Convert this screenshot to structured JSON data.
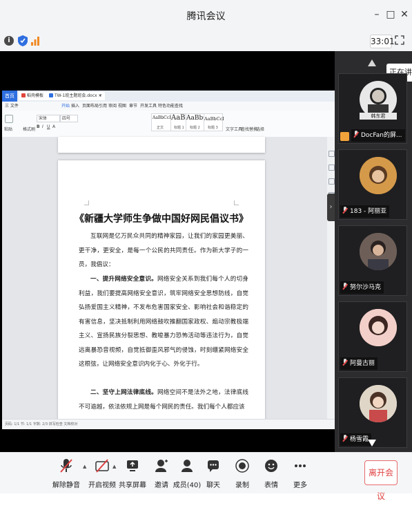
{
  "window": {
    "title": "腾讯会议"
  },
  "info_bar": {
    "timer": "33:01"
  },
  "shared_screen": {
    "wps": {
      "home_tab": "首页",
      "tabs": [
        "稻壳模板",
        "TW-1班主题班会.docx"
      ],
      "menus": [
        "三 文件",
        "开始",
        "插入",
        "页面布局",
        "引用",
        "审阅",
        "视图",
        "章节",
        "开发工具",
        "特色功能",
        "查找"
      ],
      "ribbon": {
        "paste": "粘贴",
        "format_brush": "格式刷",
        "font": "宋体",
        "font_size": "四号",
        "styles": [
          {
            "sample": "AaBbCcDd",
            "name": "正文"
          },
          {
            "sample": "AaBb",
            "name": "标题 1"
          },
          {
            "sample": "AaBbC",
            "name": "标题 2"
          },
          {
            "sample": "AaBbCcI",
            "name": "标题 3"
          }
        ],
        "text_tools": "文字工具",
        "find_replace": "查找替换",
        "select": "选择"
      },
      "document": {
        "title": "《新疆大学师生争做中国好网民倡议书》",
        "paragraphs": [
          {
            "lead": "",
            "text": "互联网是亿万民众共同的精神家园，让我们的家园更美丽、更干净，更安全，是每一个公民的共同责任。作为新大学子的一员，我倡议："
          },
          {
            "lead": "一、提升网络安全意识。",
            "text": "网络安全关系到我们每个人的切身利益，我们要提高网络安全意识，筑牢网络安全思想防线，自觉弘扬爱国主义精神，不发布危害国家安全、影响社会和谐稳定的有害信息，坚决抵制利用网络鼓吹推翻国家政权、煽动宗教极端主义、宣扬民族分裂思想、教唆暴力恐怖活动等违法行为，自觉远离暴恐音视频，自觉抵御歪风邪气的侵蚀，时刻绷紧网络安全这根弦，让网络安全意识内化于心、外化于行。"
          },
          {
            "lead": "二、坚守上网法律底线。",
            "text": "网络空间不是法外之地，法律底线不可逾越，依法依规上网是每个网民的责任。我们每个人都应该"
          }
        ]
      },
      "statusbar": "页码: 1/1  节: 1/1  字数: 2/3  拼写检查  文档校对"
    }
  },
  "side_panel": {
    "speaking_label": "正在讲话:",
    "participants": [
      {
        "name": "DocFan的屏...",
        "avatar_text": "韩东君",
        "sharing": true
      },
      {
        "name": "183 - 阿丽亚",
        "sharing": false
      },
      {
        "name": "努尔沙马克",
        "sharing": false
      },
      {
        "name": "阿曼古丽",
        "sharing": false
      },
      {
        "name": "杨雪霞",
        "sharing": false
      }
    ]
  },
  "toolbar": {
    "buttons": [
      {
        "id": "unmute",
        "label": "解除静音"
      },
      {
        "id": "start-video",
        "label": "开启视频"
      },
      {
        "id": "share-screen",
        "label": "共享屏幕"
      },
      {
        "id": "invite",
        "label": "邀请"
      },
      {
        "id": "members",
        "label": "成员(40)"
      },
      {
        "id": "chat",
        "label": "聊天"
      },
      {
        "id": "record",
        "label": "录制"
      },
      {
        "id": "reactions",
        "label": "表情"
      },
      {
        "id": "more",
        "label": "更多"
      }
    ],
    "leave_label": "离开会议"
  },
  "colors": {
    "accent": "#2f6fe0",
    "leave": "#e04040",
    "stage": "#000000",
    "panel": "#2c2c2e"
  }
}
